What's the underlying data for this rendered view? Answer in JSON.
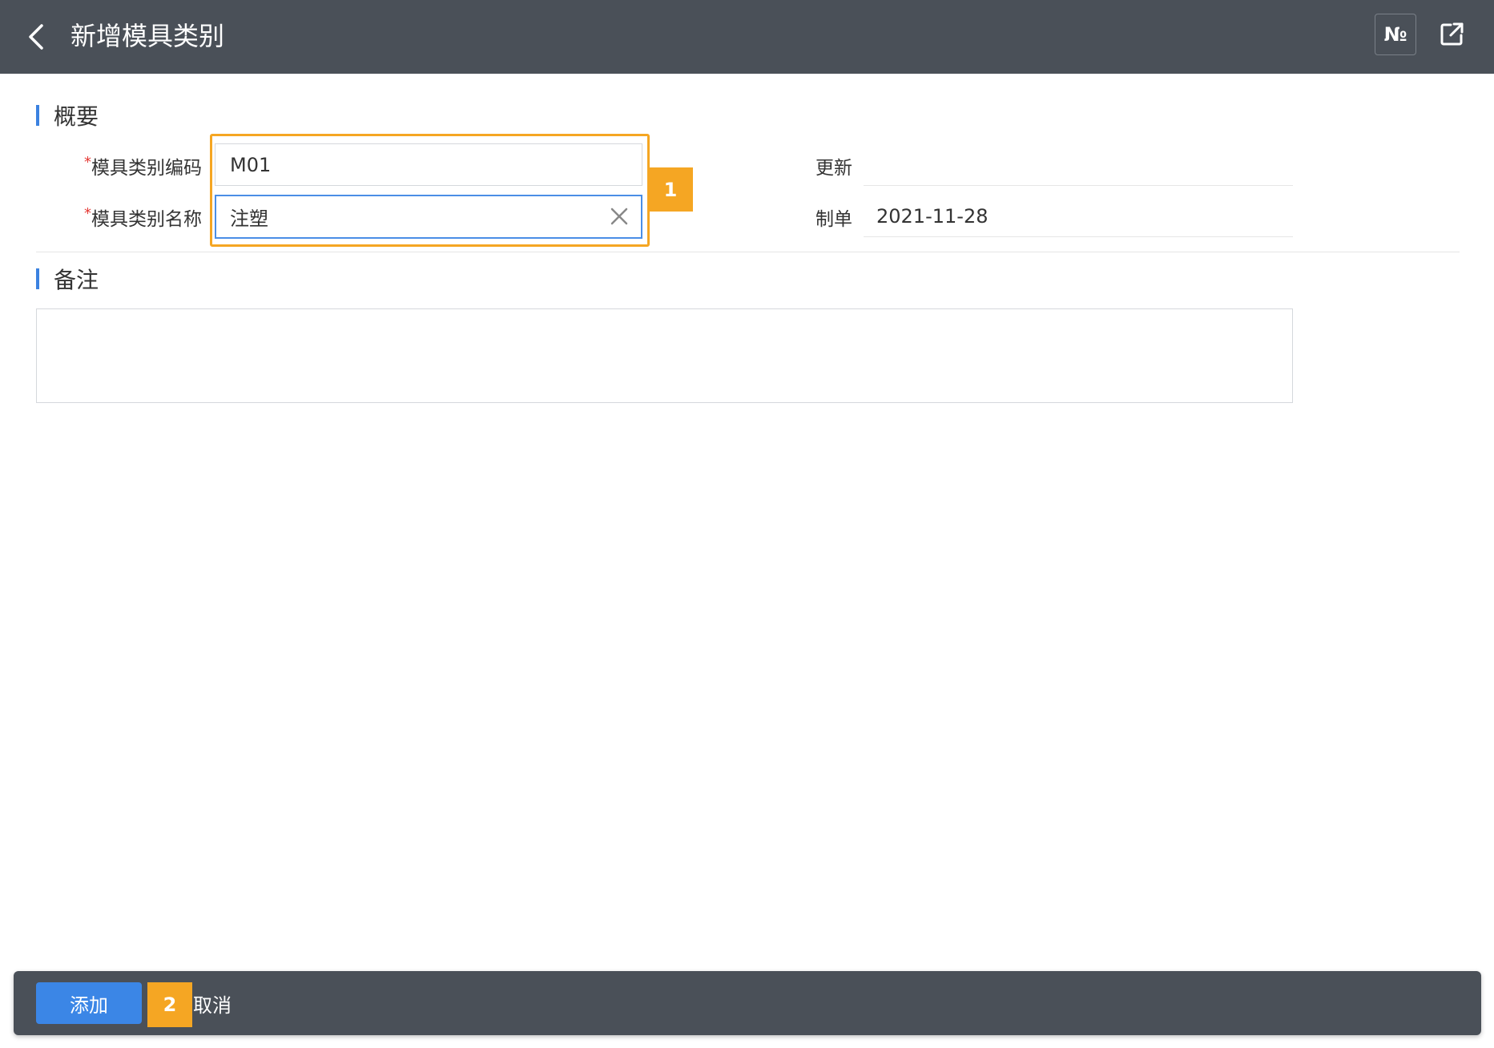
{
  "header": {
    "title": "新增模具类别",
    "number_button_label": "№",
    "back_icon": "chevron-left-icon",
    "share_icon": "external-link-icon"
  },
  "sections": {
    "summary": {
      "title": "概要"
    },
    "remark": {
      "title": "备注",
      "value": ""
    }
  },
  "form": {
    "required_mark": "*",
    "code": {
      "label": "模具类别编码",
      "value": "M01"
    },
    "name": {
      "label": "模具类别名称",
      "value": "注塑"
    },
    "update": {
      "label": "更新",
      "value": ""
    },
    "creator": {
      "label": "制单",
      "value": "2021-11-28"
    }
  },
  "annotations": {
    "badge_1": "1",
    "badge_2": "2"
  },
  "footer": {
    "add_label": "添加",
    "cancel_label": "取消"
  },
  "colors": {
    "header_bg": "#4a5058",
    "accent": "#3b82e0",
    "highlight": "#f5a623",
    "required": "#e53935"
  }
}
